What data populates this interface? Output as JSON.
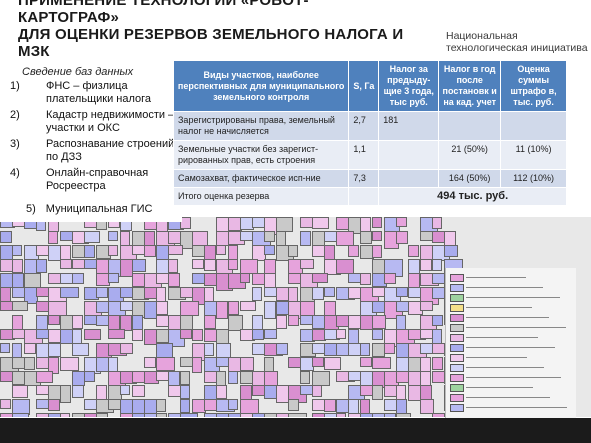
{
  "header": {
    "title_line1": "ПРИМЕНЕНИЕ ТЕХНОЛОГИИ «РОБОТ-",
    "title_line2": "КАРТОГРАФ»",
    "title_line3": "ДЛЯ ОЦЕНКИ РЕЗЕРВОВ ЗЕМЕЛЬНОГО НАЛОГА И",
    "title_line4": "МЗК",
    "brand_line1": "Национальная",
    "brand_line2": "технологическая инициатива"
  },
  "sources": {
    "heading": "Сведение баз данных",
    "items": [
      {
        "n": "1)",
        "text": "ФНС – физлица плательщики налога"
      },
      {
        "n": "2)",
        "text": "Кадастр недвижимости – участки и ОКС"
      },
      {
        "n": "3)",
        "text": "Распознавание строений по ДЗЗ"
      },
      {
        "n": "4)",
        "text": "Онлайн-справочная Росреестра"
      }
    ],
    "last": {
      "n": "5)",
      "text": "Муниципальная ГИС"
    }
  },
  "table": {
    "headers": [
      "Виды участков, наиболее перспективных для муниципального земельного контроля",
      "S, Га",
      "Налог за предыду-щие 3 года, тыс руб.",
      "Налог в год после постановк и на кад. учет",
      "Оценка суммы штрафо в, тыс. руб."
    ],
    "rows": [
      [
        "Зарегистрированы права, земельный налог не начисляется",
        "2,7",
        "181",
        "",
        ""
      ],
      [
        "Земельные участки без зарегист-рированных прав, есть строения",
        "1,1",
        "",
        "21 (50%)",
        "11 (10%)"
      ],
      [
        "Самозахват, фактическое исп-ние",
        "7,3",
        "",
        "164 (50%)",
        "112 (10%)"
      ]
    ],
    "total_label": "Итого оценка резерва",
    "total_value": "494 тыс. руб."
  }
}
